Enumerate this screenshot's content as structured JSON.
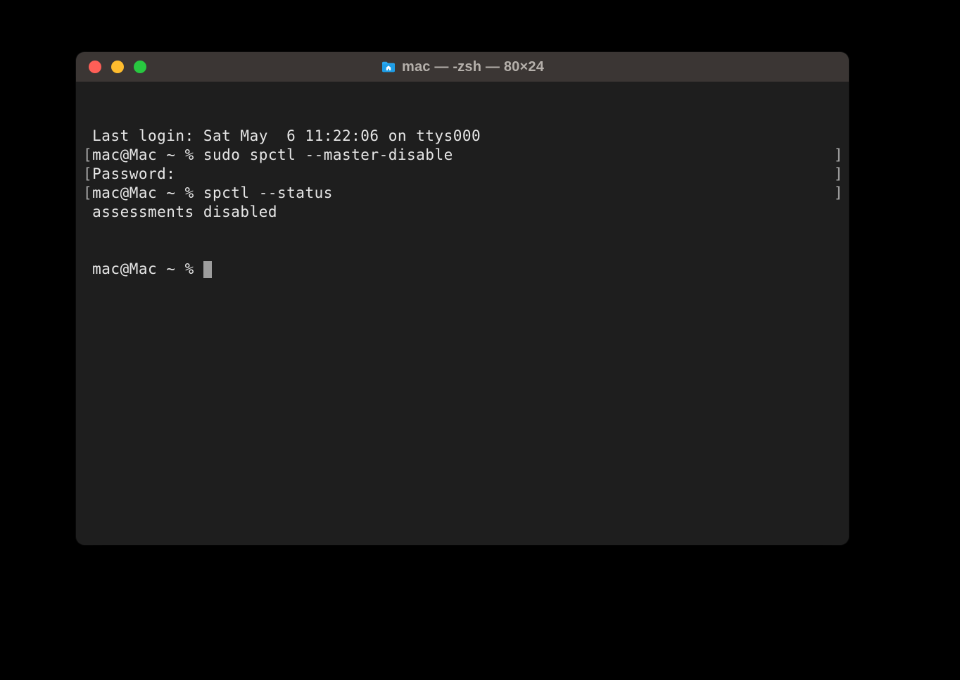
{
  "window": {
    "title": "mac — -zsh — 80×24",
    "folder_icon": "home-folder-icon"
  },
  "colors": {
    "close": "#ff5f57",
    "minimize": "#febc2e",
    "maximize": "#28c840",
    "background": "#1e1e1e",
    "titlebar": "#3b3634",
    "text": "#e6e6e6"
  },
  "terminal": {
    "lines": [
      {
        "bracket": false,
        "text": " Last login: Sat May  6 11:22:06 on ttys000"
      },
      {
        "bracket": true,
        "text": "mac@Mac ~ % sudo spctl --master-disable"
      },
      {
        "bracket": true,
        "text": "Password:"
      },
      {
        "bracket": true,
        "text": "mac@Mac ~ % spctl --status"
      },
      {
        "bracket": false,
        "text": " assessments disabled"
      }
    ],
    "prompt": " mac@Mac ~ % "
  }
}
